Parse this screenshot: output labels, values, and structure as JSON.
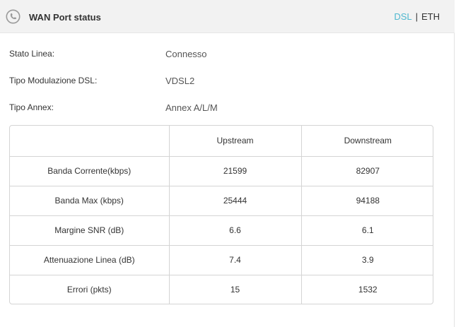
{
  "header": {
    "title": "WAN Port status",
    "icon": "phone-icon",
    "tabs": {
      "dsl": "DSL",
      "separator": "|",
      "eth": "ETH"
    },
    "active_tab": "DSL",
    "accent_color": "#4fb8cf"
  },
  "status": {
    "line_state_label": "Stato Linea:",
    "line_state_value": "Connesso",
    "modulation_label": "Tipo Modulazione DSL:",
    "modulation_value": "VDSL2",
    "annex_label": "Tipo Annex:",
    "annex_value": "Annex A/L/M"
  },
  "table": {
    "columns": [
      "",
      "Upstream",
      "Downstream"
    ],
    "rows": [
      {
        "label": "Banda Corrente(kbps)",
        "up": "21599",
        "down": "82907"
      },
      {
        "label": "Banda Max (kbps)",
        "up": "25444",
        "down": "94188"
      },
      {
        "label": "Margine SNR (dB)",
        "up": "6.6",
        "down": "6.1"
      },
      {
        "label": "Attenuazione Linea (dB)",
        "up": "7.4",
        "down": "3.9"
      },
      {
        "label": "Errori (pkts)",
        "up": "15",
        "down": "1532"
      }
    ]
  }
}
